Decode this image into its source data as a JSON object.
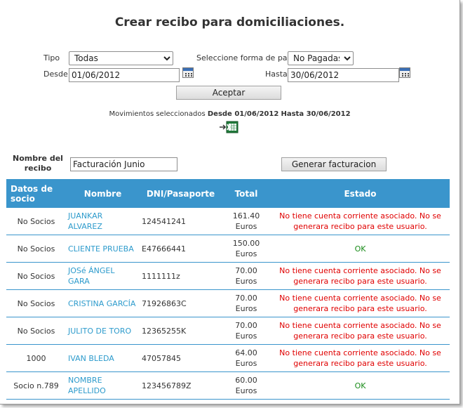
{
  "page": {
    "title": "Crear recibo para domiciliaciones."
  },
  "filters": {
    "tipo_label": "Tipo",
    "tipo_value": "Todas",
    "forma_pago_label": "Seleccione forma de pago",
    "forma_pago_value": "No Pagadas",
    "desde_label": "Desde",
    "desde_value": "01/06/2012",
    "hasta_label": "Hasta",
    "hasta_value": "30/06/2012",
    "aceptar_label": "Aceptar"
  },
  "movimientos": {
    "prefix": "Movimientos seleccionados",
    "desde_text": "Desde 01/06/2012",
    "hasta_text": "Hasta 30/06/2012"
  },
  "recibo": {
    "nombre_label": "Nombre del recibo",
    "nombre_value": "Facturación Junio",
    "generar_label": "Generar facturacion"
  },
  "table": {
    "headers": [
      "Datos de socio",
      "Nombre",
      "DNI/Pasaporte",
      "Total",
      "Estado"
    ],
    "rows": [
      {
        "socio": "No Socios",
        "nombre": "JUANKAR ALVAREZ",
        "dni": "124541241",
        "total": "161.40 Euros",
        "estado": "No tiene cuenta corriente asociado. No se generara recibo para este usuario.",
        "status": "error"
      },
      {
        "socio": "No Socios",
        "nombre": "CLIENTE PRUEBA",
        "dni": "E47666441",
        "total": "150.00 Euros",
        "estado": "OK",
        "status": "ok"
      },
      {
        "socio": "No Socios",
        "nombre": "JOSé ÁNGEL GARA",
        "dni": "1111111z",
        "total": "70.00 Euros",
        "estado": "No tiene cuenta corriente asociado. No se generara recibo para este usuario.",
        "status": "error"
      },
      {
        "socio": "No Socios",
        "nombre": "CRISTINA GARCÍA",
        "dni": "71926863C",
        "total": "70.00 Euros",
        "estado": "No tiene cuenta corriente asociado. No se generara recibo para este usuario.",
        "status": "error"
      },
      {
        "socio": "No Socios",
        "nombre": "JULITO DE TORO",
        "dni": "12365255K",
        "total": "70.00 Euros",
        "estado": "No tiene cuenta corriente asociado. No se generara recibo para este usuario.",
        "status": "error"
      },
      {
        "socio": "1000",
        "nombre": "IVAN BLEDA",
        "dni": "47057845",
        "total": "64.00 Euros",
        "estado": "No tiene cuenta corriente asociado. No se generara recibo para este usuario.",
        "status": "error"
      },
      {
        "socio": "Socio n.789",
        "nombre": "NOMBRE APELLIDO",
        "dni": "123456789Z",
        "total": "60.00 Euros",
        "estado": "OK",
        "status": "ok"
      }
    ]
  },
  "colors": {
    "header_bg": "#3a95cc",
    "link": "#2d9bcc",
    "error": "#e00000",
    "ok": "#1a8c1a"
  },
  "icons": {
    "calendar": "calendar-icon",
    "export": "excel-export-icon"
  }
}
